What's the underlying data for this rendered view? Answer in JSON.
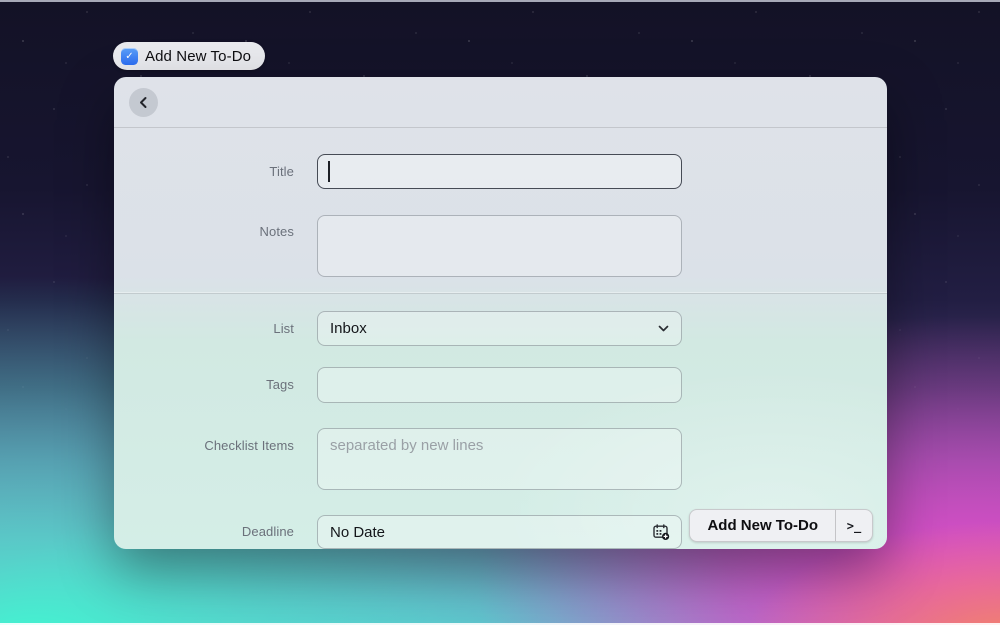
{
  "quick_action": {
    "label": "Add New To-Do",
    "icon": "todo-checkbox-icon",
    "icon_glyph": "✓"
  },
  "window": {
    "header": {
      "back_icon": "chevron-left"
    },
    "form": {
      "title": {
        "label": "Title",
        "value": ""
      },
      "notes": {
        "label": "Notes",
        "value": ""
      },
      "list": {
        "label": "List",
        "selected": "Inbox",
        "icon": "chevron-down-icon"
      },
      "tags": {
        "label": "Tags",
        "value": "",
        "placeholder": ""
      },
      "checklist": {
        "label": "Checklist Items",
        "value": "",
        "placeholder": "separated by new lines"
      },
      "deadline": {
        "label": "Deadline",
        "value": "No Date",
        "icon": "calendar-add-icon"
      }
    },
    "submit": {
      "label": "Add New To-Do",
      "shortcut_glyph": ">_",
      "shortcut_icon": "terminal-icon"
    }
  },
  "colors": {
    "accent_blue": "#2d6ef3",
    "bg_top_navy": "#16142e",
    "bg_teal": "#40f6d1",
    "bg_magenta": "#e24dcb",
    "bg_salmon": "#f58861",
    "panel_top": "#dfe2e9",
    "panel_bottom": "#d4eee7"
  }
}
